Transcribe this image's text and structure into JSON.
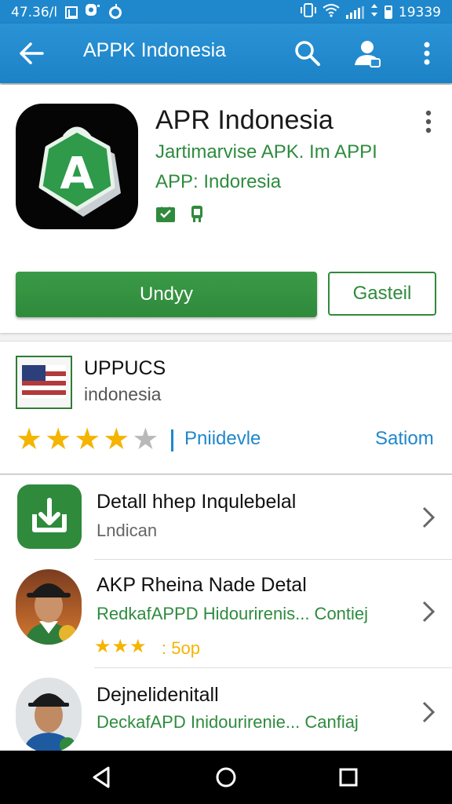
{
  "status_bar": {
    "time_left": "47.36/l",
    "time_right": "19339"
  },
  "app_bar": {
    "title": "APPK Indonesia"
  },
  "app": {
    "name": "APR Indonesia",
    "subtitle_line1": "Jartimarvise APK. Im APPI",
    "subtitle_line2": "APP: Indoresia",
    "icon_letter": "A",
    "primary_button": "Undyy",
    "secondary_button": "Gasteil"
  },
  "developer": {
    "name": "UPPUCS",
    "subtitle": "indonesia",
    "rating": 4,
    "rating_max": 5,
    "link_left": "Pniidevle",
    "link_right": "Satiom"
  },
  "list": [
    {
      "title": "Detall hhep Inqulebelal",
      "subtitle": "Lndican"
    },
    {
      "title": "AKP Rheina Nade Detal",
      "subtitle": "RedkafAPPD Hidourirenis... Contiej",
      "rating_stars": 3,
      "rating_text": ": 5op"
    },
    {
      "title": "Dejnelidenitall",
      "subtitle": "DeckafAPD Inidourirenie... Canfiaj"
    }
  ],
  "colors": {
    "primary_blue": "#1f87cc",
    "primary_green": "#2f8a3c",
    "star": "#f4b400"
  }
}
